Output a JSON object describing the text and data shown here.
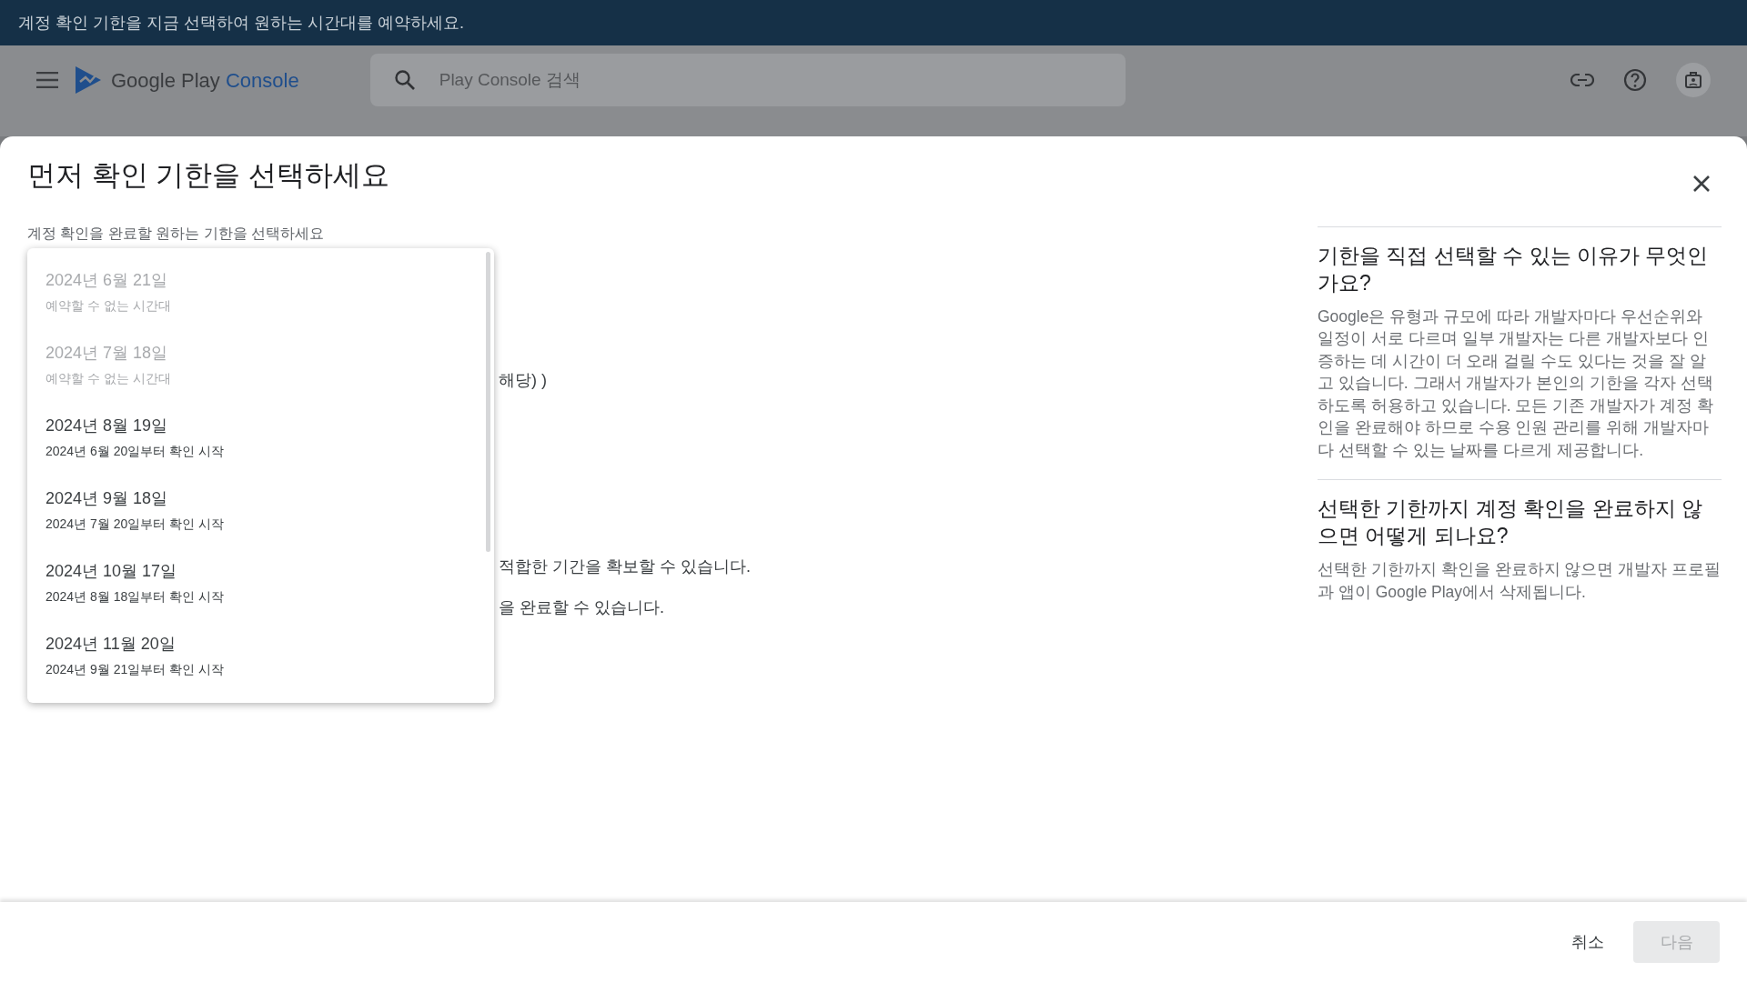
{
  "banner": {
    "text": "계정 확인 기한을 지금 선택하여 원하는 시간대를 예약하세요."
  },
  "header": {
    "logo_text": "Google Play",
    "logo_accent": "Console",
    "search": {
      "placeholder": "Play Console 검색"
    }
  },
  "dialog": {
    "title": "먼저 확인 기한을 선택하세요",
    "field_label": "계정 확인을 완료할 원하는 기한을 선택하세요",
    "partial_texts": [
      "해당) )",
      "적합한 기간을 확보할 수 있습니다.",
      "을 완료할 수 있습니다."
    ],
    "options": [
      {
        "date": "2024년 6월 21일",
        "note": "예약할 수 없는 시간대",
        "disabled": true
      },
      {
        "date": "2024년 7월 18일",
        "note": "예약할 수 없는 시간대",
        "disabled": true
      },
      {
        "date": "2024년 8월 19일",
        "note": "2024년 6월 20일부터 확인 시작",
        "disabled": false
      },
      {
        "date": "2024년 9월 18일",
        "note": "2024년 7월 20일부터 확인 시작",
        "disabled": false
      },
      {
        "date": "2024년 10월 17일",
        "note": "2024년 8월 18일부터 확인 시작",
        "disabled": false
      },
      {
        "date": "2024년 11월 20일",
        "note": "2024년 9월 21일부터 확인 시작",
        "disabled": false
      }
    ],
    "faq": [
      {
        "question": "기한을 직접 선택할 수 있는 이유가 무엇인가요?",
        "answer": "Google은 유형과 규모에 따라 개발자마다 우선순위와 일정이 서로 다르며 일부 개발자는 다른 개발자보다 인증하는 데 시간이 더 오래 걸릴 수도 있다는 것을 잘 알고 있습니다. 그래서 개발자가 본인의 기한을 각자 선택하도록 허용하고 있습니다. 모든 기존 개발자가 계정 확인을 완료해야 하므로 수용 인원 관리를 위해 개발자마다 선택할 수 있는 날짜를 다르게 제공합니다."
      },
      {
        "question": "선택한 기한까지 계정 확인을 완료하지 않으면 어떻게 되나요?",
        "answer": "선택한 기한까지 확인을 완료하지 않으면 개발자 프로필과 앱이 Google Play에서 삭제됩니다."
      }
    ],
    "buttons": [
      {
        "label": "취소",
        "disabled": false
      },
      {
        "label": "다음",
        "disabled": true
      }
    ]
  }
}
